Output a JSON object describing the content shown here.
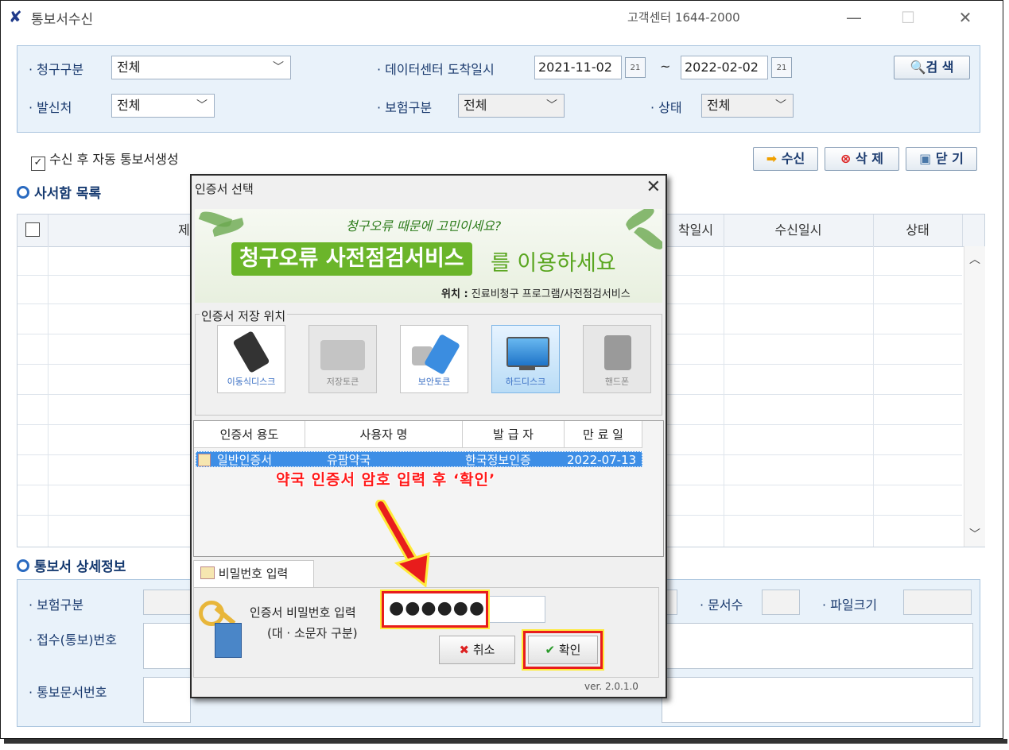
{
  "window": {
    "title": "통보서수신",
    "cc_label": "고객센터 1644-2000"
  },
  "filters": {
    "claim_label": "청구구분",
    "claim_value": "전체",
    "dc_label": "데이터센터 도착일시",
    "date_from": "2021-11-02",
    "tilde": "~",
    "date_to": "2022-02-02",
    "search_label": "검 색",
    "sender_label": "발신처",
    "sender_value": "전체",
    "ins_label": "보험구분",
    "ins_value": "전체",
    "status_label": "상태",
    "status_value": "전체"
  },
  "auto_checkbox_label": "수신 후 자동 통보서생성",
  "actions": {
    "receive": "수신",
    "delete": "삭 제",
    "close": "닫 기"
  },
  "inbox": {
    "title": "사서함 목록",
    "columns": [
      "제",
      "착일시",
      "수신일시",
      "상태"
    ]
  },
  "detail": {
    "title": "통보서 상세정보",
    "ins_label": "보험구분",
    "doc_count_label": "문서수",
    "file_size_label": "파일크기",
    "receipt_label": "접수(통보)번호",
    "notice_doc_label": "통보문서번호"
  },
  "dialog": {
    "title": "인증서 선택",
    "banner_top": "청구오류 때문에 고민이세요?",
    "banner_main": "청구오류 사전점검서비스",
    "banner_tail": "를 이용하세요",
    "banner_loc_bold": "위치 :",
    "banner_loc": "진료비청구 프로그램/사전점검서비스",
    "storage_title": "인증서 저장 위치",
    "devices": [
      "이동식디스크",
      "저장토큰",
      "보안토큰",
      "하드디스크",
      "핸드폰"
    ],
    "cert_columns": [
      "인증서 용도",
      "사용자 명",
      "발 급 자",
      "만 료 일"
    ],
    "cert_row": {
      "usage": "일반인증서",
      "user": "유팜약국",
      "issuer": "한국정보인증",
      "expiry": "2022-07-13"
    },
    "annotation": "약국 인증서 암호 입력 후 ‘확인’",
    "tab_label": "비밀번호 입력",
    "pw_label": "인증서 비밀번호 입력",
    "pw_hint": "(대 · 소문자 구분)",
    "pw_value": "●●●●●●",
    "cancel": "취소",
    "ok": "확인",
    "version": "ver. 2.0.1.0"
  }
}
